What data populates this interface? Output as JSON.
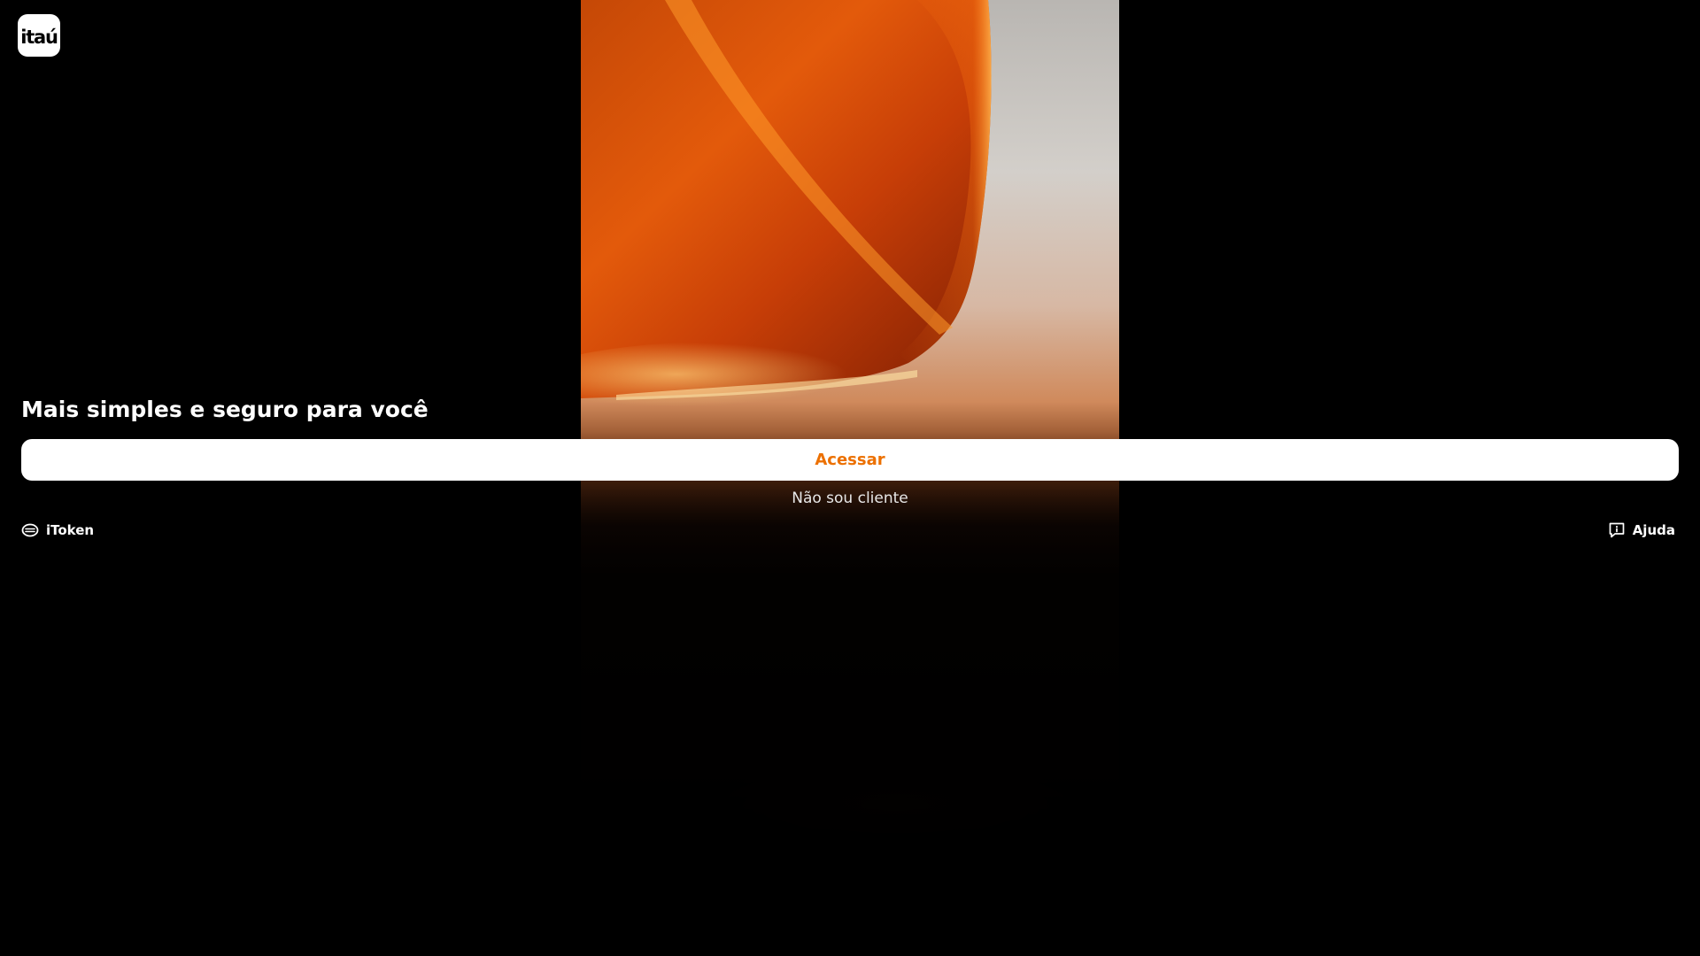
{
  "brand": {
    "logo_text": "itaú",
    "accent_color": "#ec7000"
  },
  "hero": {
    "headline": "Mais simples e seguro para você"
  },
  "actions": {
    "access_label": "Acessar",
    "not_client_label": "Não sou cliente"
  },
  "footer": {
    "itoken": {
      "label": "iToken",
      "icon": "token-icon"
    },
    "help": {
      "label": "Ajuda",
      "icon": "help-chat-icon"
    }
  }
}
